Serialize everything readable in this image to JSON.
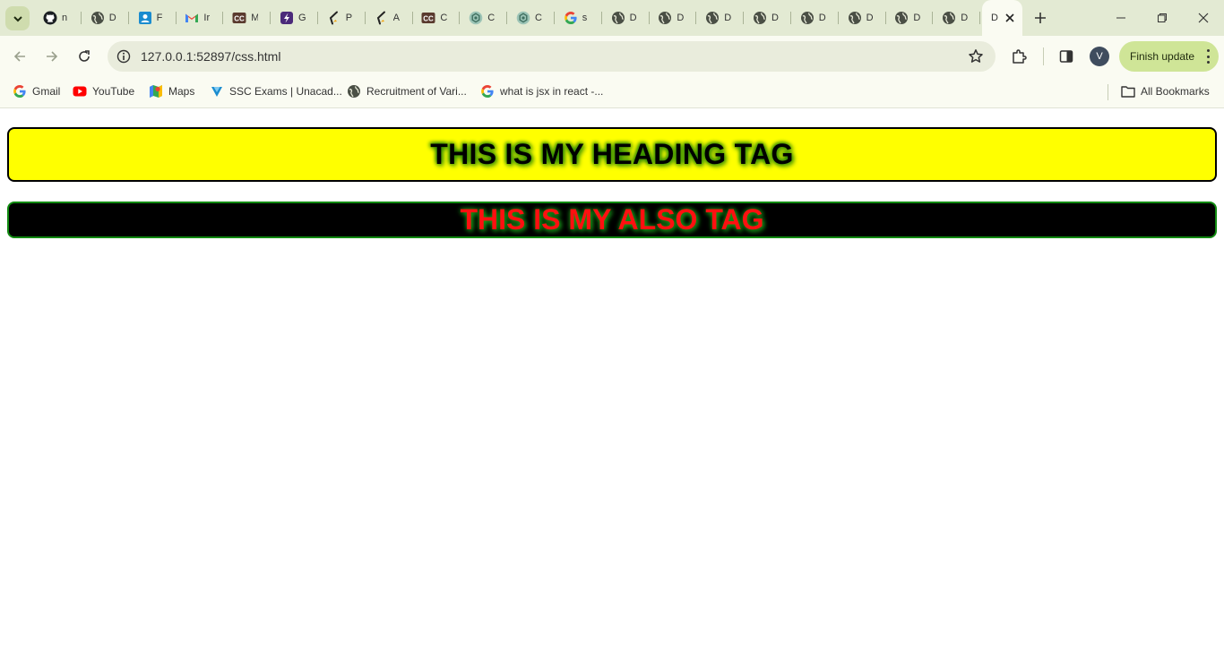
{
  "browser": {
    "tabs": [
      {
        "icon": "github-icon",
        "title": "n"
      },
      {
        "icon": "globe-icon",
        "title": "D"
      },
      {
        "icon": "contact-icon",
        "title": "F"
      },
      {
        "icon": "gmail-icon",
        "title": "Ir"
      },
      {
        "icon": "cc-icon",
        "title": "M"
      },
      {
        "icon": "bolt-icon",
        "title": "G"
      },
      {
        "icon": "pen-icon",
        "title": "P"
      },
      {
        "icon": "pen-icon",
        "title": "A"
      },
      {
        "icon": "cc-icon",
        "title": "C"
      },
      {
        "icon": "openai-icon",
        "title": "C"
      },
      {
        "icon": "openai-icon",
        "title": "C"
      },
      {
        "icon": "google-icon",
        "title": "s"
      },
      {
        "icon": "globe-icon",
        "title": "D"
      },
      {
        "icon": "globe-icon",
        "title": "D"
      },
      {
        "icon": "globe-icon",
        "title": "D"
      },
      {
        "icon": "globe-icon",
        "title": "D"
      },
      {
        "icon": "globe-icon",
        "title": "D"
      },
      {
        "icon": "globe-icon",
        "title": "D"
      },
      {
        "icon": "globe-icon",
        "title": "D"
      },
      {
        "icon": "globe-icon",
        "title": "D"
      }
    ],
    "active_tab": {
      "title": "D"
    },
    "url": "127.0.0.1:52897/css.html",
    "profile_initial": "V",
    "update_label": "Finish update"
  },
  "bookmarks": [
    {
      "icon": "google-icon",
      "label": "Gmail"
    },
    {
      "icon": "youtube-icon",
      "label": "YouTube"
    },
    {
      "icon": "maps-icon",
      "label": "Maps"
    },
    {
      "icon": "unacademy-icon",
      "label": "SSC Exams | Unacad..."
    },
    {
      "icon": "globe-icon",
      "label": "Recruitment of Vari..."
    },
    {
      "icon": "google-icon",
      "label": "what is jsx in react -..."
    }
  ],
  "all_bookmarks_label": "All Bookmarks",
  "page": {
    "heading": "THIS IS MY HEADING TAG",
    "subheading": "THIS IS MY ALSO TAG"
  },
  "colors": {
    "heading_bg": "#ffff00",
    "heading_text": "#000000",
    "subheading_bg": "#000000",
    "subheading_text": "#ff1010",
    "glow": "#2d8a00"
  }
}
